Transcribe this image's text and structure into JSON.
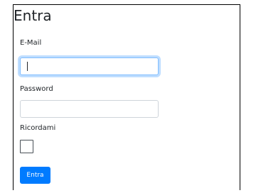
{
  "login": {
    "title": "Entra",
    "email_label": "E-Mail",
    "email_value": "",
    "password_label": "Password",
    "password_value": "",
    "remember_label": "Ricordami",
    "remember_checked": false,
    "submit_label": "Entra"
  },
  "colors": {
    "primary": "#007bff",
    "focus_border": "#80bdff",
    "input_border": "#ced4da",
    "text": "#212529"
  }
}
